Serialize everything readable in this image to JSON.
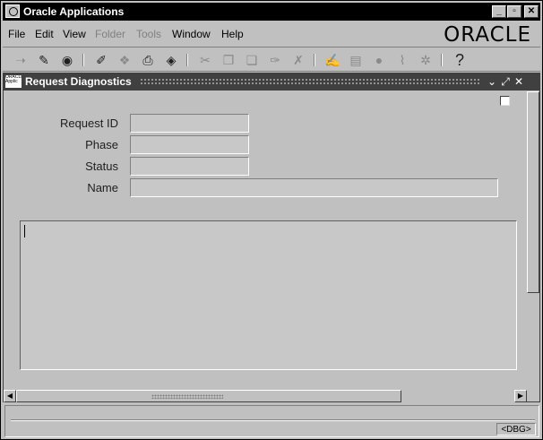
{
  "app": {
    "title": "Oracle Applications",
    "logo_text": "ORACLE",
    "window_controls": {
      "minimize": "_",
      "restore": "▫",
      "close": "✕"
    }
  },
  "menu": [
    {
      "label": "File",
      "enabled": true
    },
    {
      "label": "Edit",
      "enabled": true
    },
    {
      "label": "View",
      "enabled": true
    },
    {
      "label": "Folder",
      "enabled": false
    },
    {
      "label": "Tools",
      "enabled": false
    },
    {
      "label": "Window",
      "enabled": true
    },
    {
      "label": "Help",
      "enabled": true
    }
  ],
  "toolbar": {
    "icons": [
      "new-record-icon",
      "find-icon",
      "navigator-icon",
      "save-icon",
      "next-step-icon",
      "print-icon",
      "close-form-icon",
      "cut-icon",
      "copy-icon",
      "paste-icon",
      "new-record-line-icon",
      "delete-record-icon",
      "edit-field-icon",
      "zoom-icon",
      "translations-icon",
      "attachments-icon",
      "folder-tools-icon",
      "help-icon"
    ],
    "help_glyph": "?"
  },
  "window": {
    "title": "Request Diagnostics",
    "icon_text": "ORACLE Applic",
    "controls": {
      "minimize": "⌄",
      "maximize": "⤢",
      "close": "✕"
    }
  },
  "form": {
    "request_id": {
      "label": "Request ID",
      "value": ""
    },
    "phase": {
      "label": "Phase",
      "value": ""
    },
    "status": {
      "label": "Status",
      "value": ""
    },
    "name": {
      "label": "Name",
      "value": ""
    },
    "diagnostics_text": ""
  },
  "statusbar": {
    "message": "",
    "dbg_label": "<DBG>"
  },
  "colors": {
    "chrome": "#c0c0c0",
    "mdi_background": "#6b6b6b",
    "titlebar": "#000000",
    "window_titlebar": "#404040"
  }
}
